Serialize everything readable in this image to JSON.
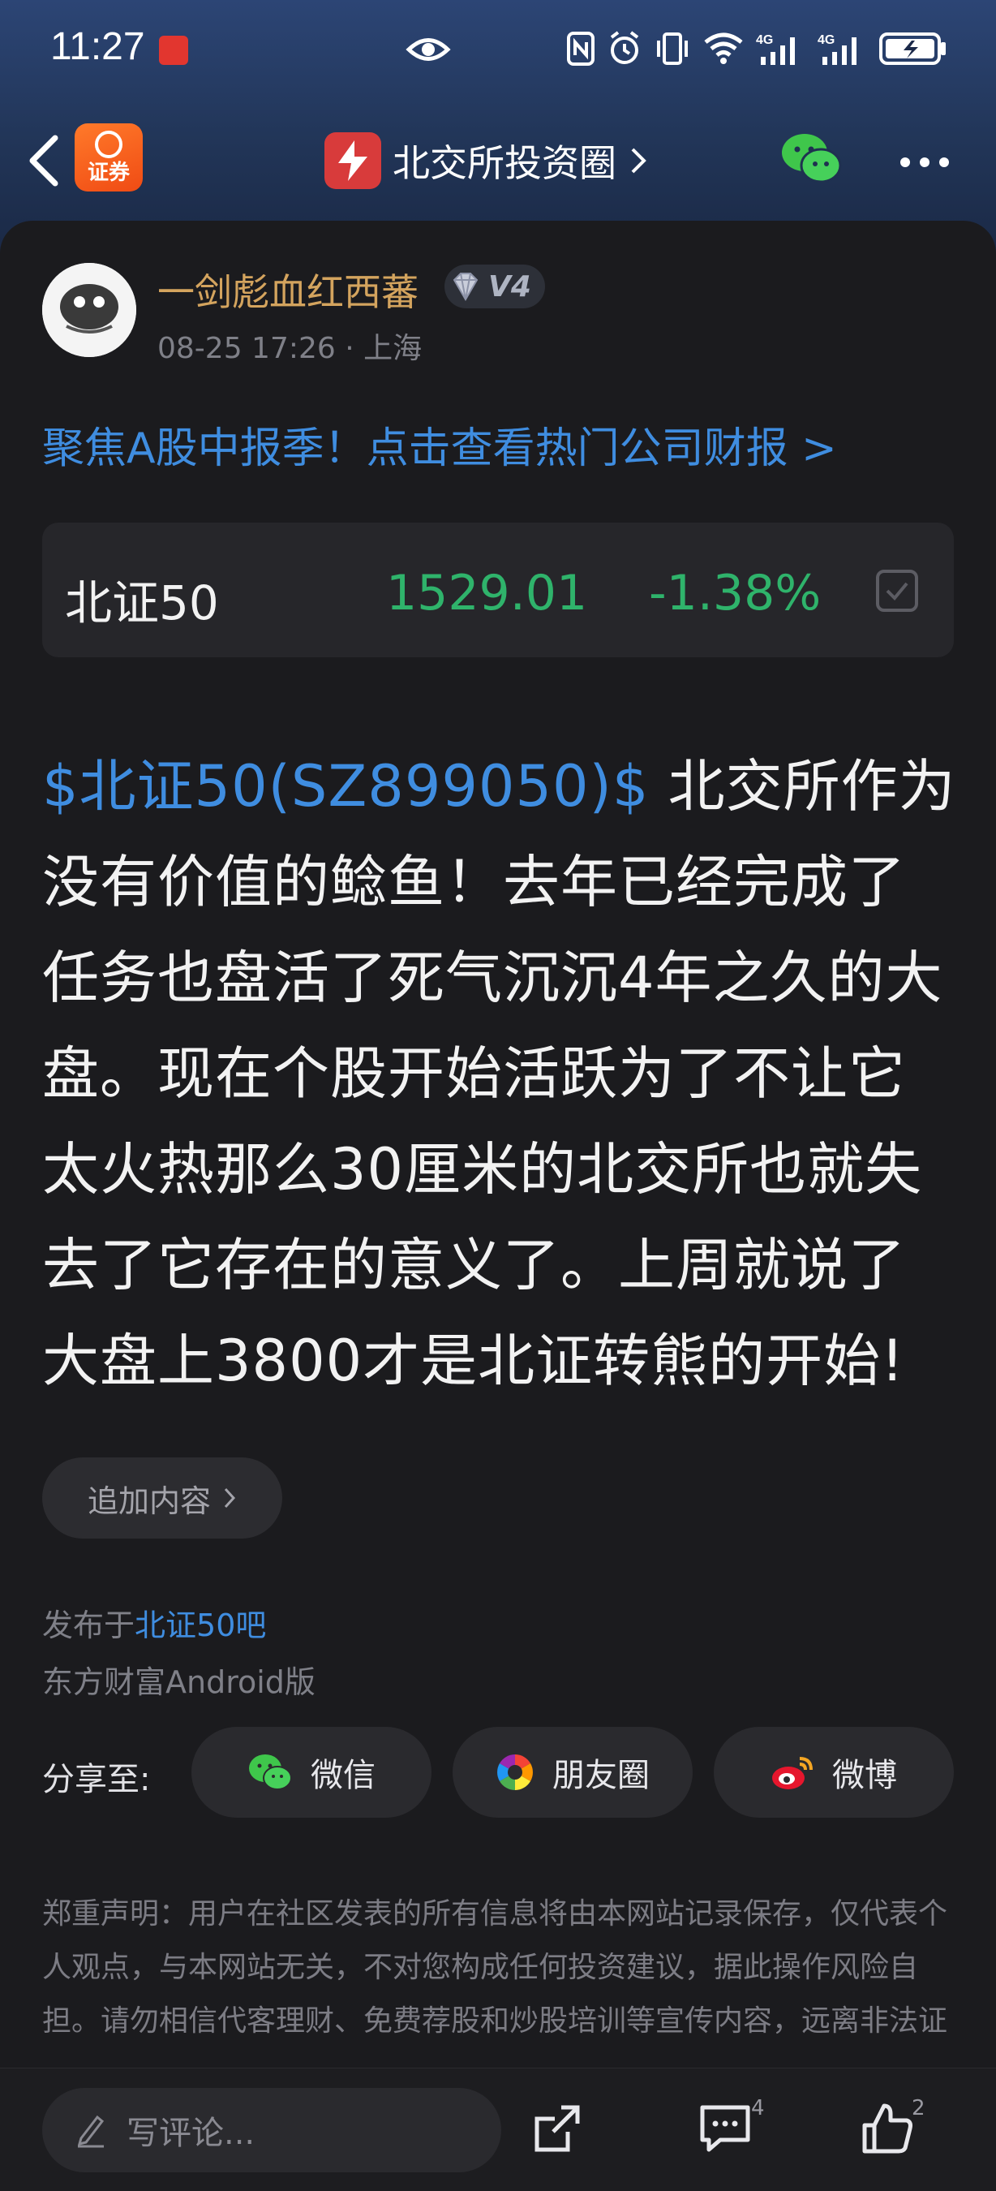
{
  "status_bar": {
    "time": "11:27",
    "network1": "4G",
    "network2": "4G"
  },
  "nav": {
    "app_logo_label": "证券",
    "forum_title": "北交所投资圈"
  },
  "post": {
    "username": "一剑彪血红西蕃",
    "level": "V4",
    "meta": "08-25 17:26 · 上海",
    "promo_link": "聚焦A股中报季！点击查看热门公司财报 >",
    "stock": {
      "name": "北证50",
      "price": "1529.01",
      "change": "-1.38%"
    },
    "mention": "$北证50(SZ899050)$",
    "body_text": " 北交所作为没有价值的鲶鱼！去年已经完成了任务也盘活了死气沉沉4年之久的大盘。现在个股开始活跃为了不让它太火热那么30厘米的北交所也就失去了它存在的意义了。上周就说了大盘上3800才是北证转熊的开始!",
    "add_content_label": "追加内容",
    "published_prefix": "发布于",
    "published_forum": "北证50吧",
    "client_version": "东方财富Android版"
  },
  "share": {
    "label": "分享至:",
    "options": [
      {
        "label": "微信",
        "icon": "wechat-icon"
      },
      {
        "label": "朋友圈",
        "icon": "moments-icon"
      },
      {
        "label": "微博",
        "icon": "weibo-icon"
      }
    ]
  },
  "disclaimer": "郑重声明：用户在社区发表的所有信息将由本网站记录保存，仅代表个人观点，与本网站无关，不对您构成任何投资建议，据此操作风险自担。请勿相信代客理财、免费荐股和炒股培训等宣传内容，远离非法证券活动。请勿添加发言用户的手机号码、公众",
  "bottom_bar": {
    "comment_placeholder": "写评论...",
    "comment_count": "4",
    "like_count": "2"
  },
  "colors": {
    "accent_blue": "#3f8de0",
    "down_green": "#2fb36b",
    "username_gold": "#d4a45e",
    "card_bg": "#1b1b1e"
  }
}
